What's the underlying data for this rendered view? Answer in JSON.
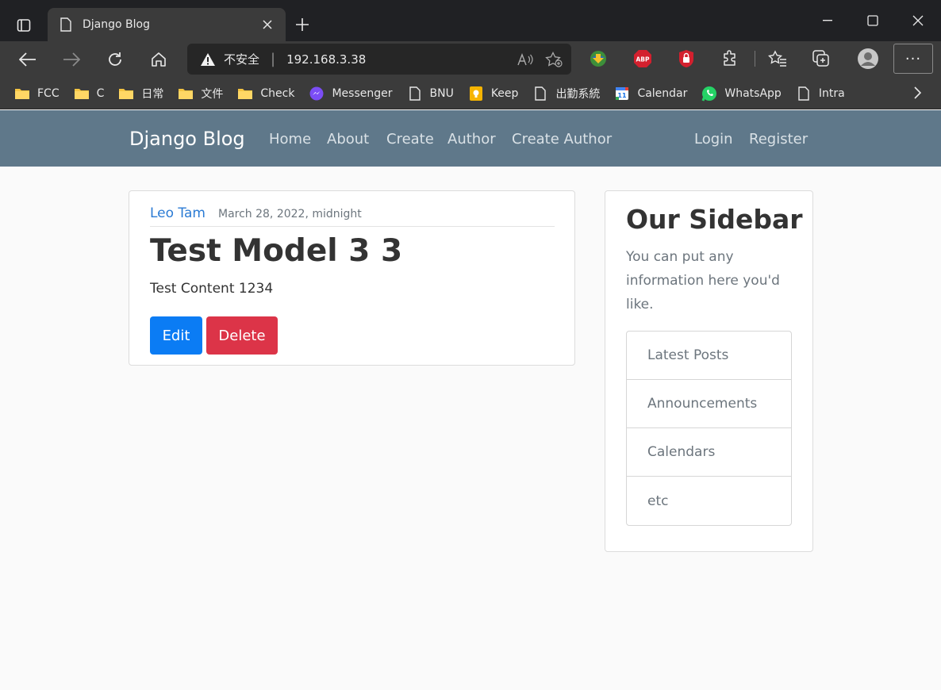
{
  "browser": {
    "tab_title": "Django Blog",
    "address": {
      "security_label": "不安全",
      "url": "192.168.3.38"
    },
    "bookmarks": [
      {
        "label": "FCC",
        "icon": "folder-icon"
      },
      {
        "label": "C",
        "icon": "folder-icon"
      },
      {
        "label": "日常",
        "icon": "folder-icon"
      },
      {
        "label": "文件",
        "icon": "folder-icon"
      },
      {
        "label": "Check",
        "icon": "folder-icon"
      },
      {
        "label": "Messenger",
        "icon": "messenger-icon"
      },
      {
        "label": "BNU",
        "icon": "page-icon"
      },
      {
        "label": "Keep",
        "icon": "keep-icon"
      },
      {
        "label": "出勤系統",
        "icon": "page-icon"
      },
      {
        "label": "Calendar",
        "icon": "calendar-icon"
      },
      {
        "label": "WhatsApp",
        "icon": "whatsapp-icon"
      },
      {
        "label": "Intra",
        "icon": "page-icon"
      }
    ],
    "extension_badges": {
      "abp": "ABP",
      "calendar_day": "11"
    }
  },
  "site": {
    "brand": "Django Blog",
    "nav": {
      "home": "Home",
      "about": "About",
      "create": "Create",
      "author": "Author",
      "create_author": "Create Author",
      "login": "Login",
      "register": "Register"
    }
  },
  "post": {
    "author": "Leo Tam",
    "date": "March 28, 2022, midnight",
    "title": "Test Model 3 3",
    "content": "Test Content 1234",
    "edit_label": "Edit",
    "delete_label": "Delete"
  },
  "sidebar": {
    "title": "Our Sidebar",
    "text": "You can put any information here you'd like.",
    "items": [
      "Latest Posts",
      "Announcements",
      "Calendars",
      "etc"
    ]
  },
  "colors": {
    "navbar": "#5f788a",
    "edit_button": "#0b7cf4",
    "delete_button": "#dc3448",
    "author_link": "#2b7bd4"
  }
}
